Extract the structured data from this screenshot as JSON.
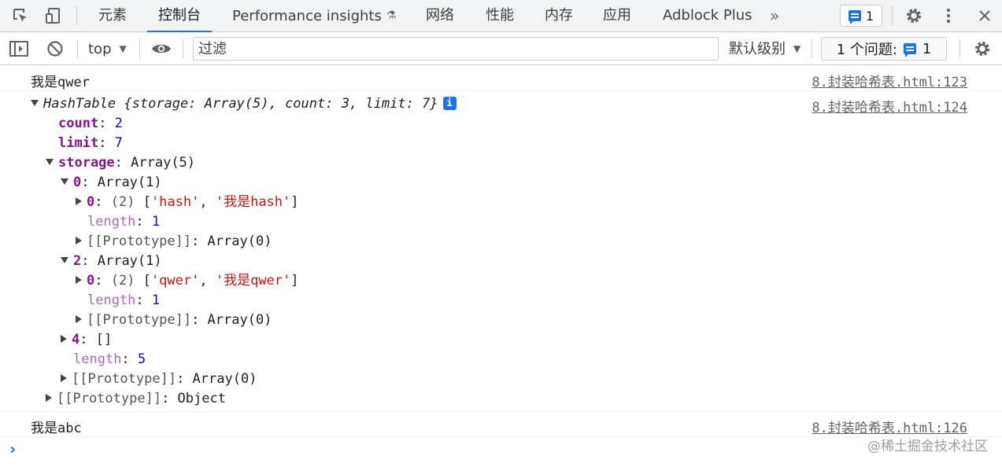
{
  "tabs": [
    {
      "label": "元素"
    },
    {
      "label": "控制台"
    },
    {
      "label": "Performance insights"
    },
    {
      "label": "网络"
    },
    {
      "label": "性能"
    },
    {
      "label": "内存"
    },
    {
      "label": "应用"
    },
    {
      "label": "Adblock Plus"
    }
  ],
  "top_right": {
    "issues_count": "1"
  },
  "toolbar": {
    "context": "top",
    "filter_placeholder": "过滤",
    "filter_value": "",
    "log_level": "默认级别",
    "issues_label": "1 个问题:",
    "issues_count": "1"
  },
  "console": {
    "messages": [
      {
        "text": "我是qwer",
        "source": "8.封装哈希表.html:123"
      },
      {
        "text": "HashTable",
        "source": "8.封装哈希表.html:124"
      },
      {
        "text": "我是abc",
        "source": "8.封装哈希表.html:126"
      }
    ],
    "hash_table": {
      "class_name": "HashTable",
      "preview": "{storage: Array(5), count: 3, limit: 7}",
      "count_key": "count",
      "count_value": "2",
      "limit_key": "limit",
      "limit_value": "7",
      "storage_key": "storage",
      "storage_type": "Array(5)",
      "item0_key": "0",
      "item0_type": "Array(1)",
      "item0_0_key": "0",
      "item0_0_len": "(2)",
      "item0_0_s1": "'hash'",
      "item0_0_s2": "'我是hash'",
      "item0_length_key": "length",
      "item0_length": "1",
      "item0_proto_key": "[[Prototype]]",
      "item0_proto": "Array(0)",
      "item2_key": "2",
      "item2_type": "Array(1)",
      "item2_0_key": "0",
      "item2_0_len": "(2)",
      "item2_0_s1": "'qwer'",
      "item2_0_s2": "'我是qwer'",
      "item2_length_key": "length",
      "item2_length": "1",
      "item2_proto_key": "[[Prototype]]",
      "item2_proto": "Array(0)",
      "item4_key": "4",
      "item4_value": "[]",
      "storage_length_key": "length",
      "storage_length": "5",
      "storage_proto_key": "[[Prototype]]",
      "storage_proto": "Array(0)",
      "obj_proto_key": "[[Prototype]]",
      "obj_proto": "Object"
    }
  },
  "watermark": "@稀土掘金技术社区"
}
